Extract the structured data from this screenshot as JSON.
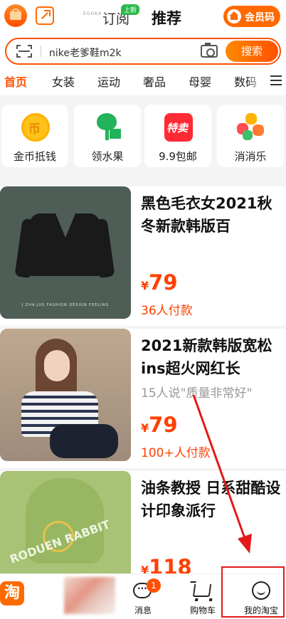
{
  "header": {
    "tab_subscribe": "订阅",
    "new_badge": "上新",
    "tab_recommend": "推荐",
    "member_code": "会员码",
    "tiny_logo_text": "EGGKA"
  },
  "search": {
    "query": "nike老爹鞋m2k",
    "button_label": "搜索"
  },
  "categories": [
    "首页",
    "女装",
    "运动",
    "奢品",
    "母婴",
    "数码"
  ],
  "quick_entries": [
    {
      "label": "金币抵钱",
      "icon": "coin-icon"
    },
    {
      "label": "领水果",
      "icon": "fruit-tree-icon"
    },
    {
      "label": "9.9包邮",
      "icon": "flash-sale-icon"
    },
    {
      "label": "消消乐",
      "icon": "candy-game-icon"
    }
  ],
  "products": [
    {
      "title": "黑色毛衣女2021秋冬新款韩版百",
      "subtitle": "",
      "currency": "¥",
      "price": "79",
      "sales": "36人付款",
      "thumb_text": "J.ZHA.JUS FASHION DESIGN FEELING"
    },
    {
      "title": "2021新款韩版宽松ins超火网红长",
      "subtitle": "15人说\"质量非常好\"",
      "currency": "¥",
      "price": "79",
      "sales": "100+人付款",
      "thumb_text": ""
    },
    {
      "title": "油条教授 日系甜酷设计印象派行",
      "subtitle": "",
      "currency": "¥",
      "price": "118",
      "sales": "",
      "thumb_text": "RODUEN RABBIT"
    }
  ],
  "bottom_bar": {
    "home_glyph": "淘",
    "messages_label": "消息",
    "messages_badge": "1",
    "cart_label": "购物车",
    "me_label": "我的淘宝"
  },
  "colors": {
    "accent": "#ff5000",
    "price": "#ff4000",
    "annotation": "#e31919"
  }
}
